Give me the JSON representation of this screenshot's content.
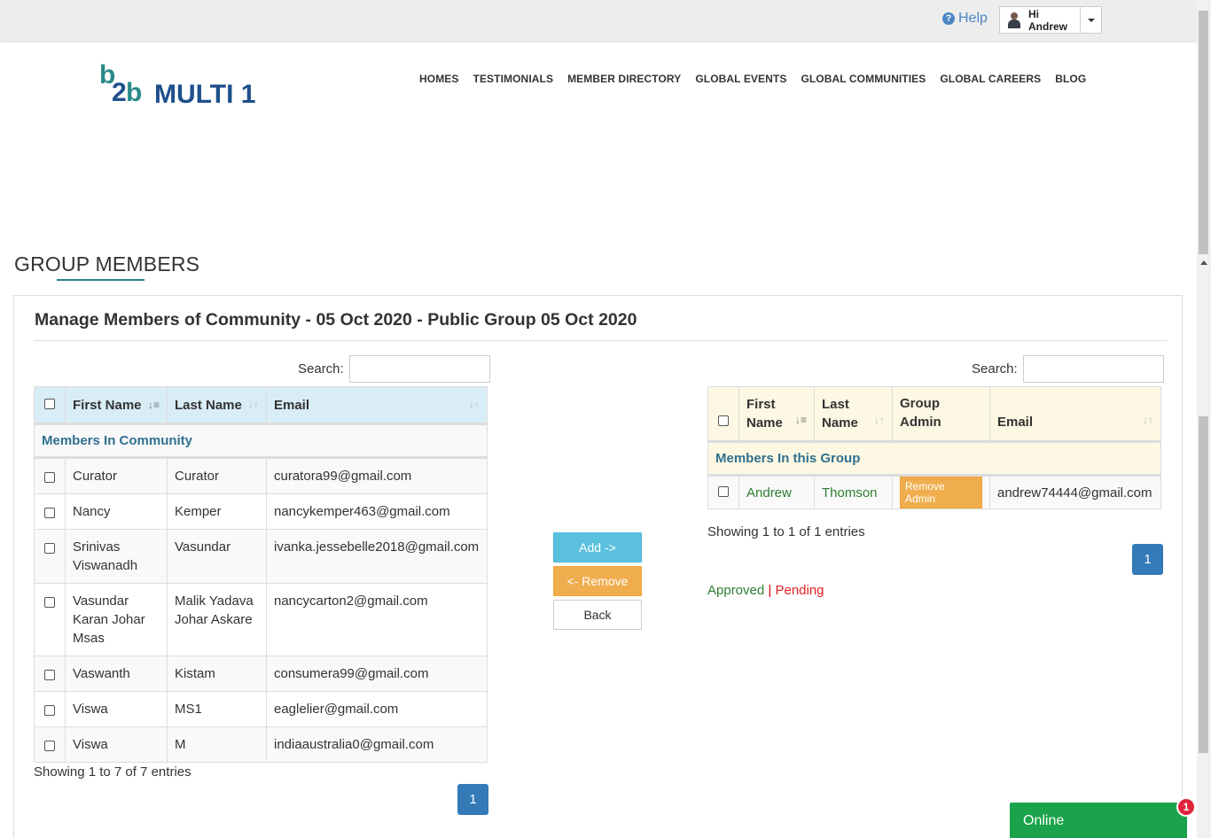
{
  "header": {
    "help_label": "Help",
    "user_greeting": "Hi Andrew"
  },
  "brand": {
    "logo_mark": "b2b",
    "logo_text": "MULTI 1",
    "colors": {
      "teal": "#2a8a8a",
      "navy": "#1e4f8c"
    }
  },
  "nav": {
    "items": [
      "HOMES",
      "TESTIMONIALS",
      "MEMBER DIRECTORY",
      "GLOBAL EVENTS",
      "GLOBAL COMMUNITIES",
      "GLOBAL CAREERS",
      "BLOG"
    ]
  },
  "page": {
    "title": "GROUP MEMBERS",
    "heading": "Manage Members of Community - 05 Oct 2020 - Public Group 05 Oct 2020"
  },
  "community_table": {
    "search_label": "Search:",
    "caption": "Members In Community",
    "columns": [
      "First Name",
      "Last Name",
      "Email"
    ],
    "rows": [
      {
        "first": "Curator",
        "last": "Curator",
        "email": "curatora99@gmail.com"
      },
      {
        "first": "Nancy",
        "last": "Kemper",
        "email": "nancykemper463@gmail.com"
      },
      {
        "first": "Srinivas Viswanadh",
        "last": "Vasundar",
        "email": "ivanka.jessebelle2018@gmail.com"
      },
      {
        "first": "Vasundar Karan Johar Msas",
        "last": "Malik Yadava Johar Askare",
        "email": "nancycarton2@gmail.com"
      },
      {
        "first": "Vaswanth",
        "last": "Kistam",
        "email": "consumera99@gmail.com"
      },
      {
        "first": "Viswa",
        "last": "MS1",
        "email": "eaglelier@gmail.com"
      },
      {
        "first": "Viswa",
        "last": "M",
        "email": "indiaaustralia0@gmail.com"
      }
    ],
    "info": "Showing 1 to 7 of 7 entries",
    "page": "1"
  },
  "actions": {
    "add": "Add ->",
    "remove": "<- Remove",
    "back": "Back"
  },
  "group_table": {
    "search_label": "Search:",
    "caption": "Members In this Group",
    "columns": [
      "First Name",
      "Last Name",
      "Group Admin",
      "Email"
    ],
    "rows": [
      {
        "first": "Andrew",
        "last": "Thomson",
        "admin_button": "Remove Admin",
        "email": "andrew74444@gmail.com"
      }
    ],
    "info": "Showing 1 to 1 of 1 entries",
    "page": "1"
  },
  "legend": {
    "approved": "Approved",
    "separator": "|",
    "pending": "Pending"
  },
  "chat": {
    "status": "Online",
    "badge_count": "1"
  }
}
